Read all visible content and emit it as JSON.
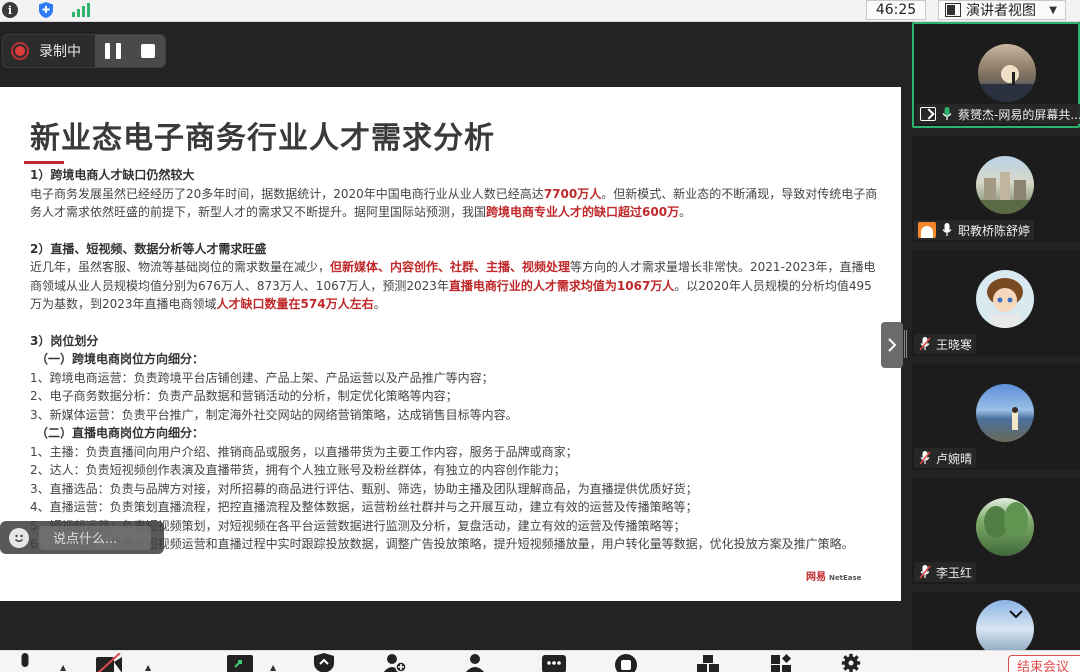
{
  "topbar": {
    "timer": "46:25",
    "view_mode": "演讲者视图"
  },
  "recording": {
    "label": "录制中"
  },
  "slide": {
    "title": "新业态电子商务行业人才需求分析",
    "sec1_title": "1）跨境电商人才缺口仍然较大",
    "sec1_p1a": "电子商务发展虽然已经经历了20多年时间，据数据统计，2020年中国电商行业从业人数已经高达",
    "sec1_p1b": "7700万人",
    "sec1_p1c": "。但新模式、新业态的不断涌现，导致对传统电子商务人才需求依然旺盛的前提下，新型人才的需求又不断提升。据阿里国际站预测，我国",
    "sec1_p1d": "跨境电商专业人才的缺口超过600万",
    "sec1_p1e": "。",
    "sec2_title": "2）直播、短视频、数据分析等人才需求旺盛",
    "sec2_p1a": "近几年，虽然客服、物流等基础岗位的需求数量在减少，",
    "sec2_p1b": "但新媒体、内容创作、社群、主播、视频处理",
    "sec2_p1c": "等方向的人才需求量增长非常快。2021-2023年，直播电商领域从业人员规模均值分别为676万人、873万人、1067万人，预测2023年",
    "sec2_p1d": "直播电商行业的人才需求均值为1067万人",
    "sec2_p1e": "。以2020年人员规模的分析均值495万为基数，到2023年直播电商领域",
    "sec2_p1f": "人才缺口数量在574万人左右",
    "sec2_p1g": "。",
    "sec3_title": "3）岗位划分",
    "sec3_sub1": "（一）跨境电商岗位方向细分：",
    "sec3_list1": [
      "1、跨境电商运营：负责跨境平台店铺创建、产品上架、产品运营以及产品推广等内容；",
      "2、电子商务数据分析：负责产品数据和营销活动的分析，制定优化策略等内容；",
      "3、新媒体运营：负责平台推广，制定海外社交网站的网络营销策略，达成销售目标等内容。"
    ],
    "sec3_sub2": "（二）直播电商岗位方向细分：",
    "sec3_list2": [
      "1、主播：负责直播间向用户介绍、推销商品或服务，以直播带货为主要工作内容，服务于品牌或商家；",
      "2、达人：负责短视频创作表演及直播带货，拥有个人独立账号及粉丝群体，有独立的内容创作能力；",
      "3、直播选品：负责与品牌方对接，对所招募的商品进行评估、甄别、筛选，协助主播及团队理解商品，为直播提供优质好货；",
      "4、直播运营：负责策划直播流程，把控直播流程及整体数据，运营粉丝社群并与之开展互动，建立有效的运营及传播策略等；",
      "5、短视频运营：负责短视频策划，对短视频在各平台运营数据进行监测及分析，复盘活动，建立有效的运营及传播策略等；",
      "6、流量投放：负责在短视频运营和直播过程中实时跟踪投放数据，调整广告投放策略，提升短视频播放量，用户转化量等数据，优化投放方案及推广策略。"
    ],
    "logo_cn": "网易",
    "logo_en": "NetEase"
  },
  "speak_box": {
    "placeholder": "说点什么..."
  },
  "participants": [
    {
      "name": "蔡赟杰-网易的屏幕共..."
    },
    {
      "name": "职教桥陈舒婷"
    },
    {
      "name": "王晓寒"
    },
    {
      "name": "卢婉晴"
    },
    {
      "name": "李玉红"
    }
  ],
  "bottombar": {
    "end_label": "结束会议"
  },
  "colors": {
    "accent_red": "#c0292b",
    "active_green": "#2fb26b"
  }
}
